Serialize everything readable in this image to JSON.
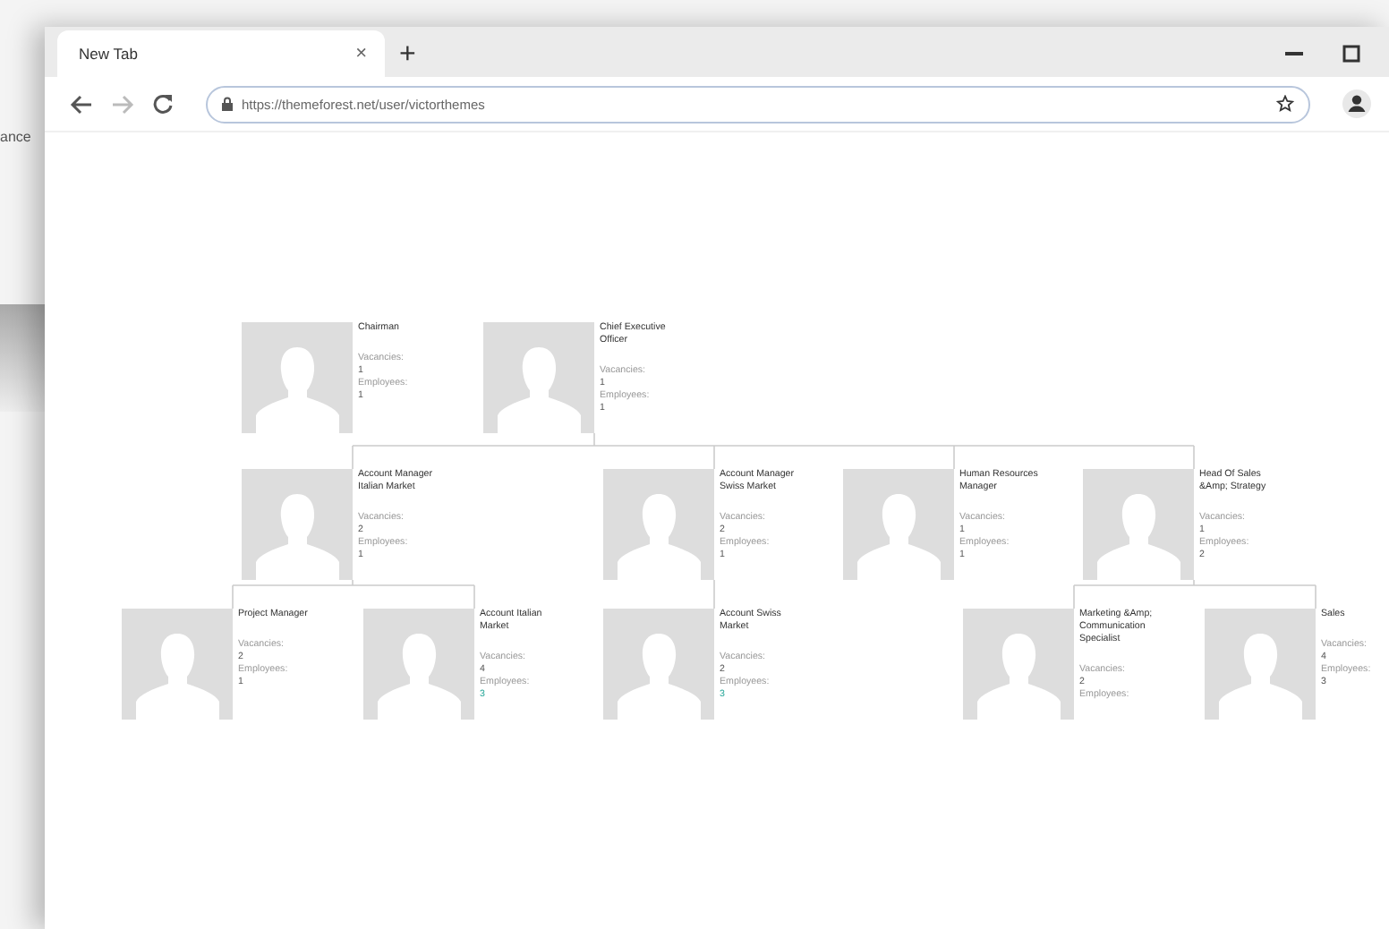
{
  "background_text": "ance",
  "window": {
    "tab": {
      "title": "New Tab",
      "close": "×"
    },
    "new_tab": "+",
    "forward": {
      "disabled": true
    },
    "address": "https://themeforest.net/user/victorthemes"
  },
  "org_chart": {
    "nodes": [
      {
        "title": "Chairman",
        "vacancies_label": "Vacancies:",
        "vacancies": "1",
        "employees_label": "Employees:",
        "employees": "1",
        "employees_link": false
      },
      {
        "title": "Chief Executive Officer",
        "vacancies_label": "Vacancies:",
        "vacancies": "1",
        "employees_label": "Employees:",
        "employees": "1",
        "employees_link": false,
        "children": [
          {
            "title": "Account Manager Italian Market",
            "vacancies_label": "Vacancies:",
            "vacancies": "2",
            "employees_label": "Employees:",
            "employees": "1",
            "employees_link": false,
            "children": [
              {
                "title": "Project Manager",
                "vacancies_label": "Vacancies:",
                "vacancies": "2",
                "employees_label": "Employees:",
                "employees": "1",
                "employees_link": false
              },
              {
                "title": "Account Italian Market",
                "vacancies_label": "Vacancies:",
                "vacancies": "4",
                "employees_label": "Employees:",
                "employees": "3",
                "employees_link": true
              }
            ]
          },
          {
            "title": "Account Manager Swiss Market",
            "vacancies_label": "Vacancies:",
            "vacancies": "2",
            "employees_label": "Employees:",
            "employees": "1",
            "employees_link": false,
            "children": [
              {
                "title": "Account Swiss Market",
                "vacancies_label": "Vacancies:",
                "vacancies": "2",
                "employees_label": "Employees:",
                "employees": "3",
                "employees_link": true
              }
            ]
          },
          {
            "title": "Human Resources Manager",
            "vacancies_label": "Vacancies:",
            "vacancies": "1",
            "employees_label": "Employees:",
            "employees": "1",
            "employees_link": false
          },
          {
            "title": "Head Of Sales &Amp; Strategy",
            "vacancies_label": "Vacancies:",
            "vacancies": "1",
            "employees_label": "Employees:",
            "employees": "2",
            "employees_link": false,
            "children": [
              {
                "title": "Marketing &Amp; Communication Specialist",
                "vacancies_label": "Vacancies:",
                "vacancies": "2",
                "employees_label": "Employees:"
              },
              {
                "title": "Sales",
                "vacancies_label": "Vacancies:",
                "vacancies": "4",
                "employees_label": "Employees:",
                "employees": "3",
                "employees_link": false
              }
            ]
          }
        ]
      }
    ]
  }
}
